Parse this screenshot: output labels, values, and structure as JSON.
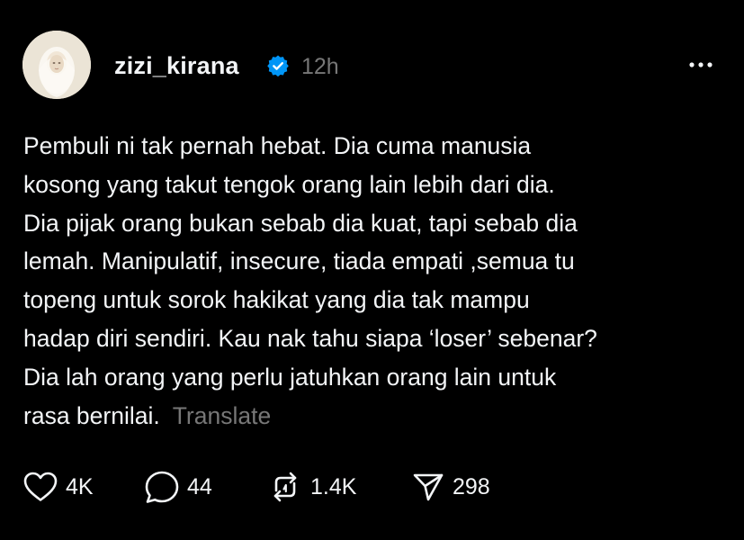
{
  "post": {
    "username": "zizi_kirana",
    "verified": true,
    "timestamp": "12h",
    "body_lines": [
      "Pembuli ni tak pernah hebat. Dia cuma manusia",
      "kosong yang takut tengok orang lain lebih dari dia.",
      "Dia pijak orang bukan sebab dia kuat, tapi sebab dia",
      "lemah. Manipulatif, insecure, tiada empati ,semua tu",
      "topeng untuk sorok hakikat yang dia tak mampu",
      "hadap diri sendiri. Kau nak tahu siapa ‘loser’ sebenar?",
      "Dia lah orang yang perlu jatuhkan orang lain untuk",
      "rasa bernilai."
    ],
    "translate_label": "Translate"
  },
  "actions": {
    "likes": "4K",
    "comments": "44",
    "reposts": "1.4K",
    "shares": "298"
  },
  "icons": {
    "more": "more-horizontal-icon",
    "verified": "verified-badge-icon",
    "like": "heart-icon",
    "comment": "comment-bubble-icon",
    "repost": "repost-icon",
    "share": "send-icon"
  },
  "colors": {
    "background": "#000000",
    "text": "#f3f5f7",
    "muted": "#777777",
    "verified": "#0095f6"
  }
}
